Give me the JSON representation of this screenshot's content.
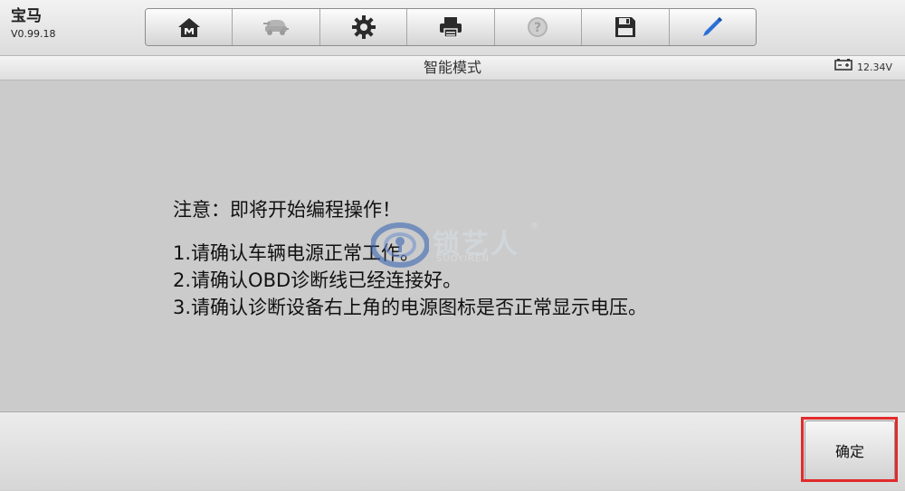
{
  "app": {
    "name": "宝马",
    "version": "V0.99.18"
  },
  "toolbar": {
    "buttons": [
      {
        "icon": "home-icon"
      },
      {
        "icon": "vehicle-swap-icon"
      },
      {
        "icon": "gear-icon"
      },
      {
        "icon": "printer-icon"
      },
      {
        "icon": "help-icon"
      },
      {
        "icon": "save-icon"
      },
      {
        "icon": "pen-icon"
      }
    ]
  },
  "header": {
    "title": "智能模式",
    "battery_voltage": "12.34V"
  },
  "notice": {
    "heading": "注意：即将开始编程操作！",
    "items": [
      "1.请确认车辆电源正常工作。",
      "2.请确认OBD诊断线已经连接好。",
      "3.请确认诊断设备右上角的电源图标是否正常显示电压。"
    ]
  },
  "watermark": {
    "text": "锁艺人",
    "subtext": "SUOYIREN",
    "mark": "®"
  },
  "footer": {
    "confirm_label": "确定"
  },
  "colors": {
    "highlight": "#e12b2b",
    "pen_accent": "#2a6fd6"
  }
}
